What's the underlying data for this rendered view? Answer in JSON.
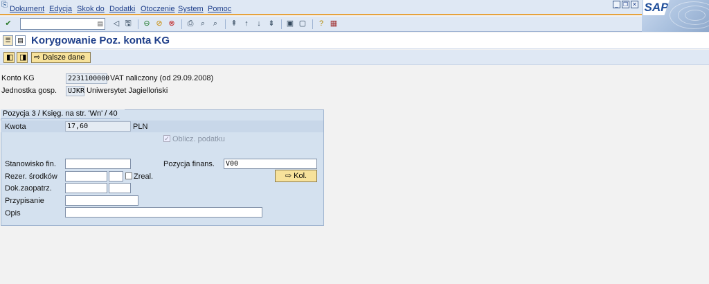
{
  "menu": {
    "items": [
      {
        "label": "Dokument"
      },
      {
        "label": "Edycja"
      },
      {
        "label": "Skok do"
      },
      {
        "label": "Dodatki"
      },
      {
        "label": "Otoczenie"
      },
      {
        "label": "System"
      },
      {
        "label": "Pomoc"
      }
    ]
  },
  "logo": {
    "text": "SAP"
  },
  "header": {
    "title": "Korygowanie Poz. konta KG"
  },
  "app_toolbar": {
    "more_data_label": "Dalsze dane"
  },
  "header_fields": {
    "gl_account_label": "Konto KG",
    "gl_account_value": "2231100000",
    "gl_account_desc": "VAT naliczony (od 29.09.2008)",
    "company_code_label": "Jednostka gosp.",
    "company_code_value": "UJKR",
    "company_code_desc": "Uniwersytet Jagielloński"
  },
  "group": {
    "title": "Pozycja 3 / Księg. na str. 'Wn' / 40",
    "amount_label": "Kwota",
    "amount_value": "17,60",
    "currency": "PLN",
    "calc_tax_label": "Oblicz. podatku",
    "calc_tax_checked": true,
    "cost_center_label": "Stanowisko fin.",
    "cost_center_value": "",
    "fin_position_label": "Pozycja finans.",
    "fin_position_value": "V00",
    "earmarked_label": "Rezer. środków",
    "earmarked_value": "",
    "earmarked_item_value": "",
    "realized_label": "Zreal.",
    "realized_checked": false,
    "kol_button_label": "Kol.",
    "purchasing_doc_label": "Dok.zaopatrz.",
    "purchasing_doc_value": "",
    "purchasing_doc_item_value": "",
    "assignment_label": "Przypisanie",
    "assignment_value": "",
    "text_label": "Opis",
    "text_value": ""
  }
}
